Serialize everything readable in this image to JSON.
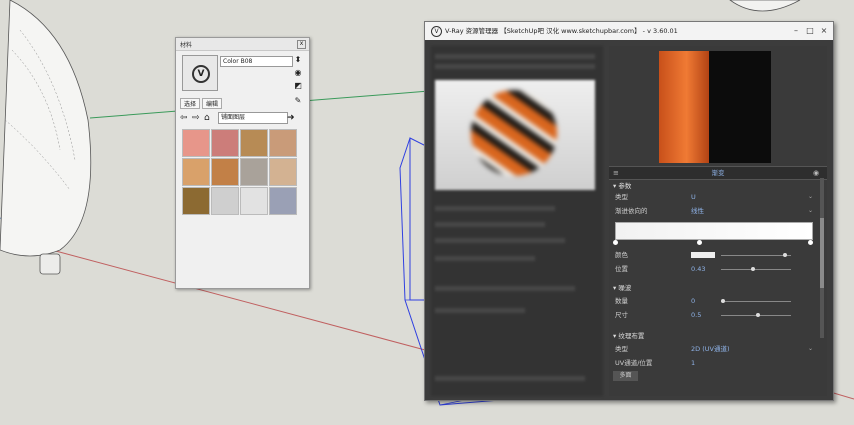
{
  "materials_panel": {
    "title": "材料",
    "close": "x",
    "material_name": "Color B08",
    "tabs": [
      "选择",
      "编辑"
    ],
    "collection": "铺面图层",
    "swatches": [
      "#e7968a",
      "#cc7d7a",
      "#b78b55",
      "#c99b79",
      "#d9a16a",
      "#c28047",
      "#a9a29a",
      "#d3b292",
      "#8c6a32",
      "#cfcfcf",
      "#e2e2e2",
      "#9aa0b5"
    ]
  },
  "vray_editor": {
    "title": "V-Ray 资源管理器 【SketchUp吧 汉化 www.sketchupbar.com】 - v 3.60.01",
    "header_label": "渐变",
    "params_section": "参数",
    "type_label": "类型",
    "type_value": "U",
    "interp_label": "渐进依向的",
    "interp_value": "线性",
    "color_label": "颜色",
    "position_label": "位置",
    "position_value": "0.43",
    "noise_section": "噪波",
    "amount_label": "数量",
    "amount_value": "0",
    "size_label": "尺寸",
    "size_value": "0.5",
    "placement_section": "纹理布置",
    "placement_type_label": "类型",
    "placement_type_value": "2D (UV通道)",
    "uv_label": "UV通道/位置",
    "uv_value": "1",
    "bottom_button": "多面",
    "gradient_left": "#f2f2f2",
    "gradient_right": "#ffffff",
    "preview_orange": "#f07a34",
    "accent": "#8fb3e8"
  }
}
